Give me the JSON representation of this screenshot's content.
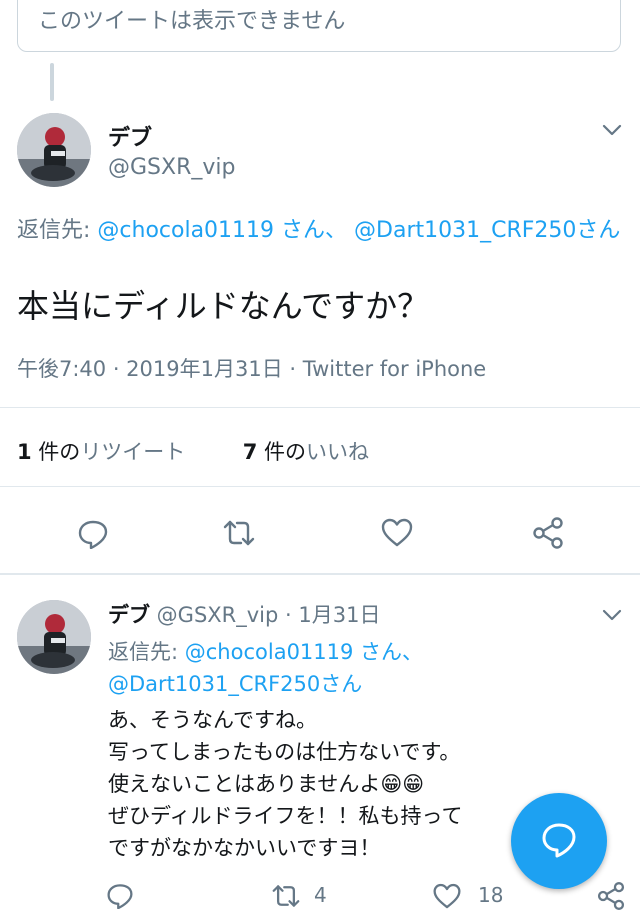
{
  "unavailable_text": "このツイートは表示できません",
  "main_tweet": {
    "display_name": "デブ",
    "handle": "@GSXR_vip",
    "reply_prefix": "返信先: ",
    "reply_user1": "@chocola01119 さん",
    "reply_sep": "、 ",
    "reply_user2": "@Dart1031_CRF250",
    "reply_suffix": "さん",
    "text": "本当にディルドなんですか？",
    "meta": "午後7:40 · 2019年1月31日 · Twitter for iPhone",
    "retweets_count": "1",
    "retweets_label": " 件の",
    "retweets_word": "リツイート",
    "likes_count": "7",
    "likes_label": " 件の",
    "likes_word": "いいね"
  },
  "reply_tweet": {
    "display_name": "デブ",
    "handle_date": " @GSXR_vip · 1月31日",
    "reply_prefix": "返信先: ",
    "reply_user1": "@chocola01119 さん、",
    "reply_user2": "@Dart1031_CRF250",
    "reply_suffix": "さん",
    "lines": [
      "あ、そうなんですね。",
      "写ってしまったものは仕方ないです。",
      "使えないことはありませんよ😁😁",
      "ぜひディルドライフを！！私も持って",
      "ですがなかなかいいですヨ！"
    ],
    "retweets": "4",
    "likes": "18"
  },
  "colors": {
    "accent": "#1da1f2",
    "muted": "#657786",
    "divider": "#e1e8ed"
  },
  "icons": [
    "chevron-down-icon",
    "reply-icon",
    "retweet-icon",
    "like-icon",
    "share-icon",
    "compose-reply-icon"
  ]
}
